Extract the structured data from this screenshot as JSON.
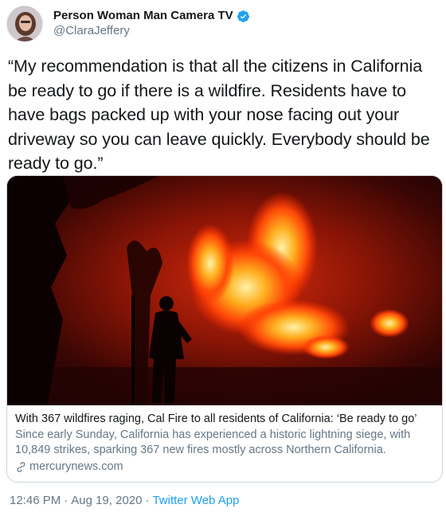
{
  "author": {
    "display_name": "Person Woman Man Camera TV",
    "handle": "@ClaraJeffery",
    "verified": true,
    "avatar_icon": "user-avatar"
  },
  "tweet": {
    "text": "“My recommendation is that all the citizens in California be ready to go if there is a wildfire. Residents have to have bags packed up with your nose facing out your driveway so you can leave quickly. Everybody should be ready to go.”"
  },
  "card": {
    "image_alt_icon": "wildfire-photo",
    "title": "With 367 wildfires raging, Cal Fire to all residents of California: ‘Be ready to go’",
    "description": "Since early Sunday, California has experienced a historic lightning siege, with 10,849 strikes, sparking 367 new fires mostly across Northern California.",
    "domain": "mercurynews.com",
    "link_icon": "link-icon"
  },
  "footer": {
    "time": "12:46 PM",
    "separator_1": "·",
    "date": "Aug 19, 2020",
    "separator_2": "·",
    "source": "Twitter Web App"
  },
  "colors": {
    "verified_badge": "#1da1f2",
    "secondary_text": "#657786",
    "link": "#1da1f2",
    "border": "#ccd6dd"
  }
}
